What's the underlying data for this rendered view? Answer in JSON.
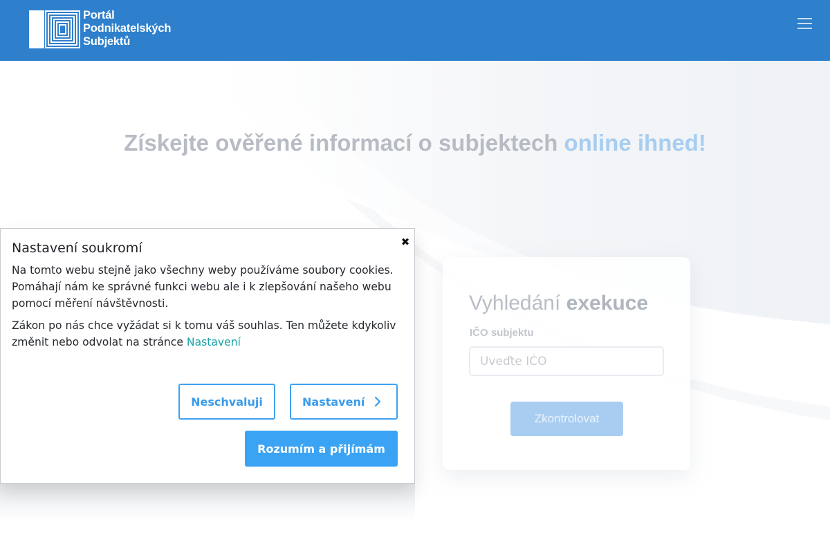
{
  "header": {
    "logo_lines": [
      "Portál",
      "Podnikatelských",
      "Subjektů"
    ],
    "menu_icon": "hamburger-icon",
    "background_color": "#2f80cc"
  },
  "hero": {
    "title_main": "Získejte ověřené informací o subjektech ",
    "title_accent": "online ihned!"
  },
  "search_card": {
    "title_light": "Vyhledání ",
    "title_bold": "exekuce",
    "field_label": "IČO subjektu",
    "input_placeholder": "Uveďte IČO",
    "submit_label": "Zkontrolovat"
  },
  "cookie_dialog": {
    "title": "Nastavení soukromí",
    "close_icon": "close-icon",
    "paragraph_1": "Na tomto webu stejně jako všechny weby používáme soubory cookies. Pomáhají nám ke správné funkci webu ale i k zlepšování našeho webu pomocí měření návštěvnosti.",
    "paragraph_2": "Zákon po nás chce vyžádat si k tomu váš souhlas. Ten můžete kdykoliv změnit nebo odvolat na stránce ",
    "settings_link": "Nastavení",
    "reject_label": "Neschvaluji",
    "settings_label": "Nastavení",
    "accept_label": "Rozumím a přijímám",
    "accent_color": "#3aa3f4",
    "link_color": "#1aa3a8"
  }
}
